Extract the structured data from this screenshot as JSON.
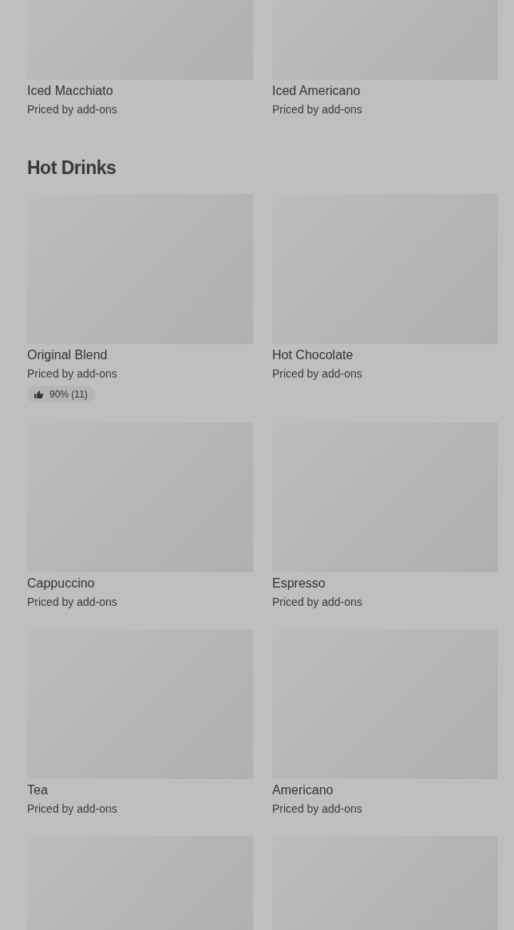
{
  "sections": [
    {
      "items": [
        {
          "name": "Iced Macchiato",
          "price": "Priced by add-ons"
        },
        {
          "name": "Iced Americano",
          "price": "Priced by add-ons"
        }
      ]
    },
    {
      "title": "Hot Drinks",
      "items": [
        {
          "name": "Original Blend",
          "price": "Priced by add-ons",
          "rating": "90% (11)"
        },
        {
          "name": "Hot Chocolate",
          "price": "Priced by add-ons"
        },
        {
          "name": "Cappuccino",
          "price": "Priced by add-ons"
        },
        {
          "name": "Espresso",
          "price": "Priced by add-ons"
        },
        {
          "name": "Tea",
          "price": "Priced by add-ons"
        },
        {
          "name": "Americano",
          "price": "Priced by add-ons"
        }
      ]
    }
  ]
}
